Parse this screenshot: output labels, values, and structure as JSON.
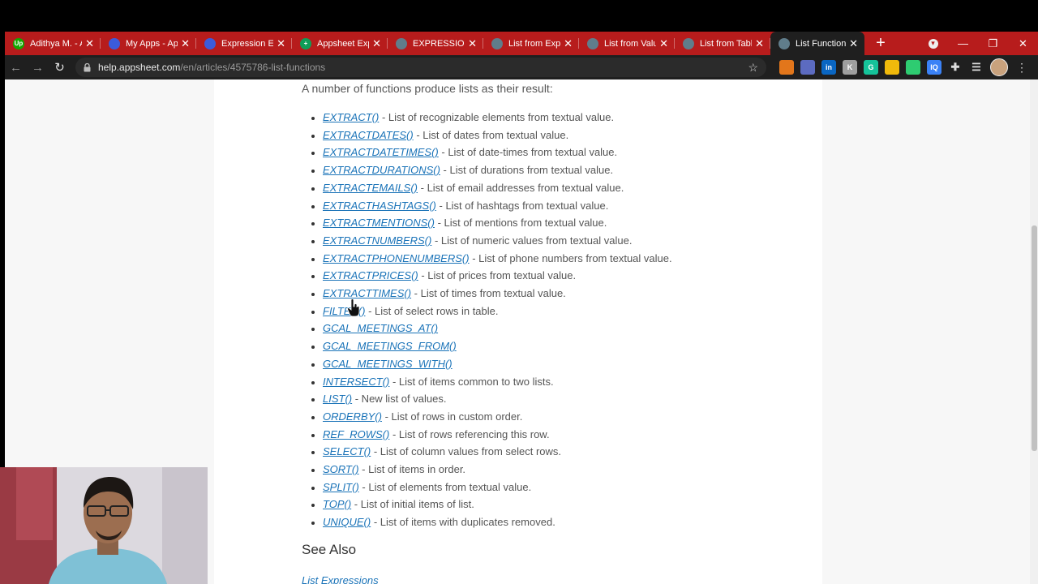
{
  "browser": {
    "tabs": [
      {
        "title": "Adithya M. - A",
        "fav_bg": "#14a800",
        "fav_text": "Up",
        "active": false
      },
      {
        "title": "My Apps - App",
        "fav_bg": "#3b5bdb",
        "fav_text": "",
        "active": false
      },
      {
        "title": "Expression Exp",
        "fav_bg": "#3b5bdb",
        "fav_text": "",
        "active": false
      },
      {
        "title": "Appsheet Expr",
        "fav_bg": "#0f9d58",
        "fav_text": "+",
        "active": false
      },
      {
        "title": "EXPRESSIONS",
        "fav_bg": "#607d8b",
        "fav_text": "",
        "active": false
      },
      {
        "title": "List from Expr",
        "fav_bg": "#607d8b",
        "fav_text": "",
        "active": false
      },
      {
        "title": "List from Valu",
        "fav_bg": "#607d8b",
        "fav_text": "",
        "active": false
      },
      {
        "title": "List from Table",
        "fav_bg": "#607d8b",
        "fav_text": "",
        "active": false
      },
      {
        "title": "List Functions",
        "fav_bg": "#607d8b",
        "fav_text": "",
        "active": true
      }
    ],
    "new_tab_glyph": "+",
    "close_glyph": "✕",
    "window_controls": {
      "minimize": "—",
      "restore": "❐",
      "close": "✕"
    },
    "url": {
      "host": "help.appsheet.com",
      "path": "/en/articles/4575786-list-functions"
    },
    "extensions": [
      {
        "name": "metamask-icon",
        "color": "#e2761b",
        "text": ""
      },
      {
        "name": "extension-icon",
        "color": "#5c6bc0",
        "text": ""
      },
      {
        "name": "linkedin-icon",
        "color": "#0a66c2",
        "text": "in"
      },
      {
        "name": "k-extension-icon",
        "color": "#9e9e9e",
        "text": "K"
      },
      {
        "name": "grammarly-icon",
        "color": "#15c39a",
        "text": "G"
      },
      {
        "name": "binance-icon",
        "color": "#f0b90b",
        "text": ""
      },
      {
        "name": "grid-extension-icon",
        "color": "#2ecc71",
        "text": ""
      },
      {
        "name": "iq-extension-icon",
        "color": "#3b82f6",
        "text": "IQ"
      }
    ]
  },
  "article": {
    "intro": "A number of functions produce lists as their result:",
    "functions": [
      {
        "name": "EXTRACT()",
        "desc": " - List of recognizable elements from textual value."
      },
      {
        "name": "EXTRACTDATES()",
        "desc": " - List of dates from textual value."
      },
      {
        "name": "EXTRACTDATETIMES()",
        "desc": " - List of date-times from textual value."
      },
      {
        "name": "EXTRACTDURATIONS()",
        "desc": " - List of durations from textual value."
      },
      {
        "name": "EXTRACTEMAILS()",
        "desc": " - List of email addresses from textual value."
      },
      {
        "name": "EXTRACTHASHTAGS()",
        "desc": " - List of hashtags from textual value."
      },
      {
        "name": "EXTRACTMENTIONS()",
        "desc": " - List of mentions from textual value."
      },
      {
        "name": "EXTRACTNUMBERS()",
        "desc": " - List of numeric values from textual value."
      },
      {
        "name": "EXTRACTPHONENUMBERS()",
        "desc": " - List of phone numbers from textual value."
      },
      {
        "name": "EXTRACTPRICES()",
        "desc": " - List of prices from textual value."
      },
      {
        "name": "EXTRACTTIMES()",
        "desc": " - List of times from textual value."
      },
      {
        "name": "FILTER()",
        "desc": " - List of select rows in table."
      },
      {
        "name": "GCAL_MEETINGS_AT()",
        "desc": ""
      },
      {
        "name": "GCAL_MEETINGS_FROM()",
        "desc": ""
      },
      {
        "name": "GCAL_MEETINGS_WITH()",
        "desc": ""
      },
      {
        "name": "INTERSECT()",
        "desc": " - List of items common to two lists."
      },
      {
        "name": "LIST()",
        "desc": " - New list of values."
      },
      {
        "name": "ORDERBY()",
        "desc": " - List of rows in custom order."
      },
      {
        "name": "REF_ROWS()",
        "desc": " - List of rows referencing this row."
      },
      {
        "name": "SELECT()",
        "desc": " - List of column values from select rows."
      },
      {
        "name": "SORT()",
        "desc": " - List of items in order."
      },
      {
        "name": "SPLIT()",
        "desc": " - List of elements from textual value."
      },
      {
        "name": "TOP()",
        "desc": " - List of initial items of list."
      },
      {
        "name": "UNIQUE()",
        "desc": " - List of items with duplicates removed."
      }
    ],
    "see_also_heading": "See Also",
    "see_also_link": "List Expressions"
  }
}
